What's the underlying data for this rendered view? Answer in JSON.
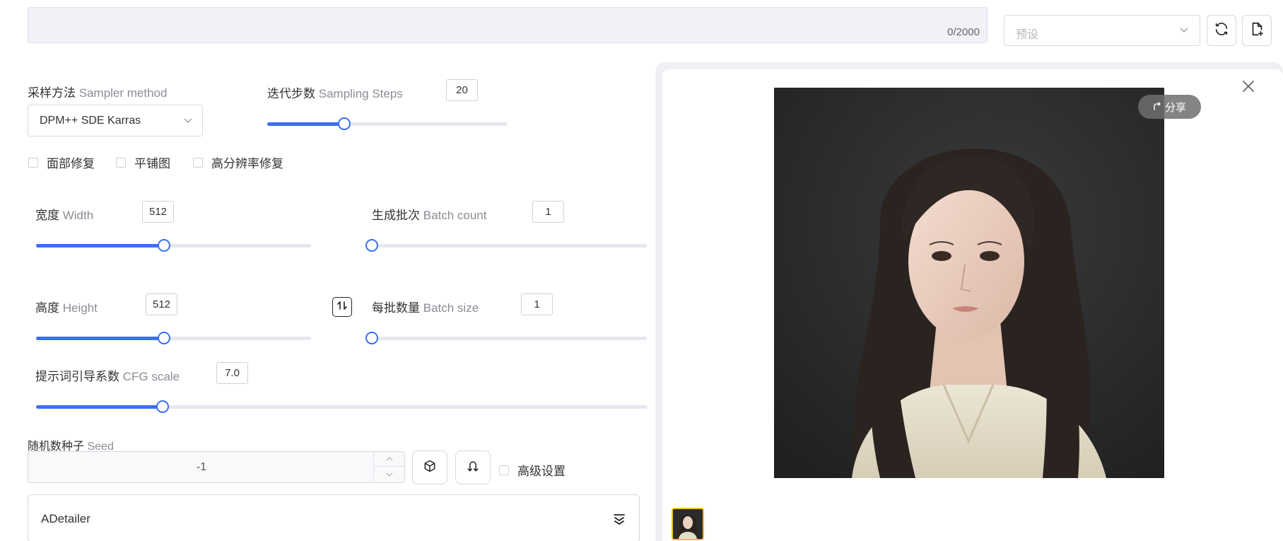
{
  "prompt": {
    "counter": "0/2000"
  },
  "preset": {
    "placeholder": "预设"
  },
  "sampler": {
    "label_cn": "采样方法",
    "label_en": "Sampler method",
    "value": "DPM++ SDE Karras"
  },
  "steps": {
    "label_cn": "迭代步数",
    "label_en": "Sampling Steps",
    "value": "20",
    "fraction": 0.32
  },
  "checkboxes": {
    "face_restore": "面部修复",
    "tiling": "平铺图",
    "hires_fix": "高分辨率修复",
    "advanced": "高级设置"
  },
  "width": {
    "label_cn": "宽度",
    "label_en": "Width",
    "value": "512",
    "fraction": 0.465
  },
  "height": {
    "label_cn": "高度",
    "label_en": "Height",
    "value": "512",
    "fraction": 0.465
  },
  "batch_count": {
    "label_cn": "生成批次",
    "label_en": "Batch count",
    "value": "1",
    "fraction": 0.0
  },
  "batch_size": {
    "label_cn": "每批数量",
    "label_en": "Batch size",
    "value": "1",
    "fraction": 0.0
  },
  "cfg": {
    "label_cn": "提示词引导系数",
    "label_en": "CFG scale",
    "value": "7.0",
    "fraction": 0.207
  },
  "seed": {
    "label_cn": "随机数种子",
    "label_en": "Seed",
    "value": "-1"
  },
  "adetailer": {
    "label": "ADetailer"
  },
  "result": {
    "share_label": "分享"
  },
  "colors": {
    "accent": "#3b6ef7",
    "thumb_border": "#f2c21b"
  }
}
